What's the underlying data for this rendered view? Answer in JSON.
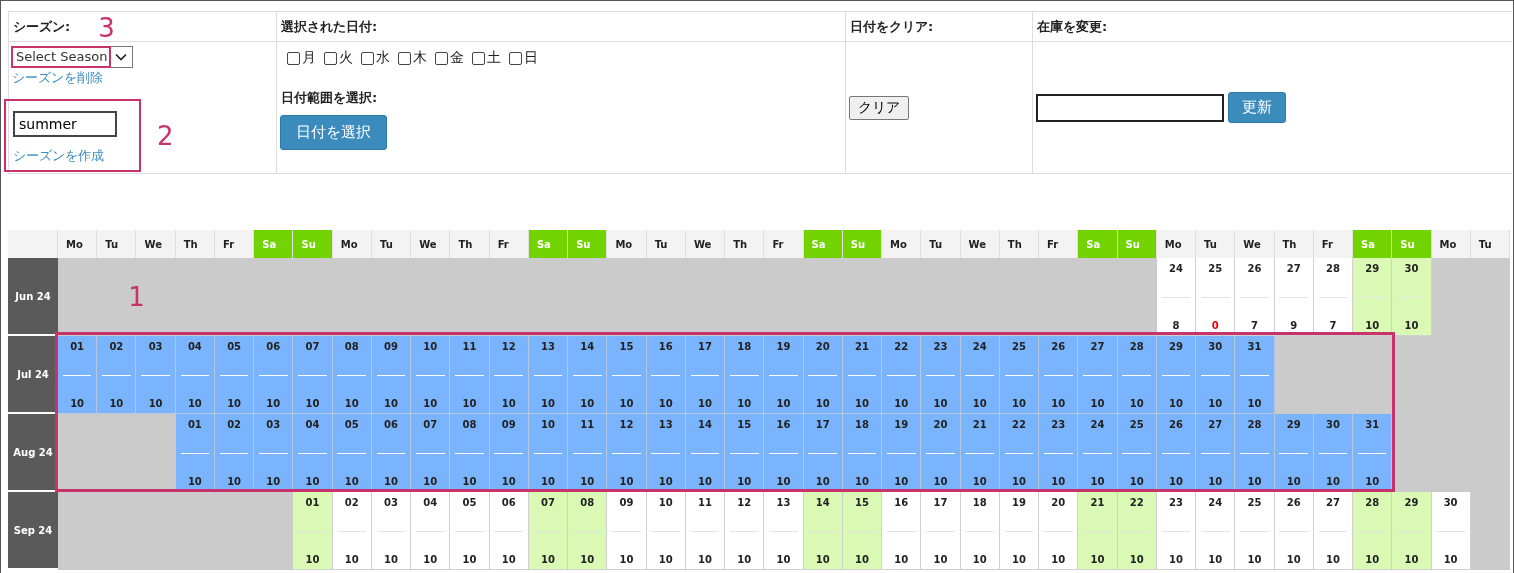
{
  "settings": {
    "season": {
      "title": "シーズン:",
      "select_value": "Select Season",
      "delete_link": "シーズンを削除",
      "annotation": "3"
    },
    "new_season": {
      "value": "summer",
      "create_link": "シーズンを作成",
      "annotation": "2"
    },
    "selected_dates": {
      "title": "選択された日付:",
      "weekdays": [
        {
          "label": "月",
          "checked": false
        },
        {
          "label": "火",
          "checked": false
        },
        {
          "label": "水",
          "checked": false
        },
        {
          "label": "木",
          "checked": false
        },
        {
          "label": "金",
          "checked": false
        },
        {
          "label": "土",
          "checked": false
        },
        {
          "label": "日",
          "checked": false
        }
      ],
      "range_title": "日付範囲を選択:",
      "range_button": "日付を選択"
    },
    "clear": {
      "title": "日付をクリア:",
      "button": "クリア"
    },
    "stock": {
      "title": "在庫を変更:",
      "button": "更新"
    }
  },
  "calendar": {
    "annotation": "1",
    "weekdays": [
      {
        "label": "Mo",
        "weekend": false
      },
      {
        "label": "Tu",
        "weekend": false
      },
      {
        "label": "We",
        "weekend": false
      },
      {
        "label": "Th",
        "weekend": false
      },
      {
        "label": "Fr",
        "weekend": false
      },
      {
        "label": "Sa",
        "weekend": true
      },
      {
        "label": "Su",
        "weekend": true
      },
      {
        "label": "Mo",
        "weekend": false
      },
      {
        "label": "Tu",
        "weekend": false
      },
      {
        "label": "We",
        "weekend": false
      },
      {
        "label": "Th",
        "weekend": false
      },
      {
        "label": "Fr",
        "weekend": false
      },
      {
        "label": "Sa",
        "weekend": true
      },
      {
        "label": "Su",
        "weekend": true
      },
      {
        "label": "Mo",
        "weekend": false
      },
      {
        "label": "Tu",
        "weekend": false
      },
      {
        "label": "We",
        "weekend": false
      },
      {
        "label": "Th",
        "weekend": false
      },
      {
        "label": "Fr",
        "weekend": false
      },
      {
        "label": "Sa",
        "weekend": true
      },
      {
        "label": "Su",
        "weekend": true
      },
      {
        "label": "Mo",
        "weekend": false
      },
      {
        "label": "Tu",
        "weekend": false
      },
      {
        "label": "We",
        "weekend": false
      },
      {
        "label": "Th",
        "weekend": false
      },
      {
        "label": "Fr",
        "weekend": false
      },
      {
        "label": "Sa",
        "weekend": true
      },
      {
        "label": "Su",
        "weekend": true
      },
      {
        "label": "Mo",
        "weekend": false
      },
      {
        "label": "Tu",
        "weekend": false
      },
      {
        "label": "We",
        "weekend": false
      },
      {
        "label": "Th",
        "weekend": false
      },
      {
        "label": "Fr",
        "weekend": false
      },
      {
        "label": "Sa",
        "weekend": true
      },
      {
        "label": "Su",
        "weekend": true
      },
      {
        "label": "Mo",
        "weekend": false
      },
      {
        "label": "Tu",
        "weekend": false
      }
    ],
    "months": [
      {
        "label": "Jun 24",
        "cells": [
          {
            "kind": "empty"
          },
          {
            "kind": "empty"
          },
          {
            "kind": "empty"
          },
          {
            "kind": "empty"
          },
          {
            "kind": "empty"
          },
          {
            "kind": "empty"
          },
          {
            "kind": "empty"
          },
          {
            "kind": "empty"
          },
          {
            "kind": "empty"
          },
          {
            "kind": "empty"
          },
          {
            "kind": "empty"
          },
          {
            "kind": "empty"
          },
          {
            "kind": "empty"
          },
          {
            "kind": "empty"
          },
          {
            "kind": "empty"
          },
          {
            "kind": "empty"
          },
          {
            "kind": "empty"
          },
          {
            "kind": "empty"
          },
          {
            "kind": "empty"
          },
          {
            "kind": "empty"
          },
          {
            "kind": "empty"
          },
          {
            "kind": "empty"
          },
          {
            "kind": "empty"
          },
          {
            "kind": "empty"
          },
          {
            "kind": "empty"
          },
          {
            "kind": "empty"
          },
          {
            "kind": "empty"
          },
          {
            "kind": "empty"
          },
          {
            "kind": "day",
            "day": "24",
            "stock": "8",
            "alert": false,
            "selected": false
          },
          {
            "kind": "day",
            "day": "25",
            "stock": "0",
            "alert": true,
            "selected": false
          },
          {
            "kind": "day",
            "day": "26",
            "stock": "7",
            "alert": false,
            "selected": false
          },
          {
            "kind": "day",
            "day": "27",
            "stock": "9",
            "alert": false,
            "selected": false
          },
          {
            "kind": "day",
            "day": "28",
            "stock": "7",
            "alert": false,
            "selected": false
          },
          {
            "kind": "day",
            "day": "29",
            "stock": "10",
            "alert": false,
            "selected": false
          },
          {
            "kind": "day",
            "day": "30",
            "stock": "10",
            "alert": false,
            "selected": false
          }
        ]
      },
      {
        "label": "Jul 24",
        "cells": [
          {
            "kind": "day",
            "day": "01",
            "stock": "10",
            "alert": false,
            "selected": true
          },
          {
            "kind": "day",
            "day": "02",
            "stock": "10",
            "alert": false,
            "selected": true
          },
          {
            "kind": "day",
            "day": "03",
            "stock": "10",
            "alert": false,
            "selected": true
          },
          {
            "kind": "day",
            "day": "04",
            "stock": "10",
            "alert": false,
            "selected": true
          },
          {
            "kind": "day",
            "day": "05",
            "stock": "10",
            "alert": false,
            "selected": true
          },
          {
            "kind": "day",
            "day": "06",
            "stock": "10",
            "alert": false,
            "selected": true
          },
          {
            "kind": "day",
            "day": "07",
            "stock": "10",
            "alert": false,
            "selected": true
          },
          {
            "kind": "day",
            "day": "08",
            "stock": "10",
            "alert": false,
            "selected": true
          },
          {
            "kind": "day",
            "day": "09",
            "stock": "10",
            "alert": false,
            "selected": true
          },
          {
            "kind": "day",
            "day": "10",
            "stock": "10",
            "alert": false,
            "selected": true
          },
          {
            "kind": "day",
            "day": "11",
            "stock": "10",
            "alert": false,
            "selected": true
          },
          {
            "kind": "day",
            "day": "12",
            "stock": "10",
            "alert": false,
            "selected": true
          },
          {
            "kind": "day",
            "day": "13",
            "stock": "10",
            "alert": false,
            "selected": true
          },
          {
            "kind": "day",
            "day": "14",
            "stock": "10",
            "alert": false,
            "selected": true
          },
          {
            "kind": "day",
            "day": "15",
            "stock": "10",
            "alert": false,
            "selected": true
          },
          {
            "kind": "day",
            "day": "16",
            "stock": "10",
            "alert": false,
            "selected": true
          },
          {
            "kind": "day",
            "day": "17",
            "stock": "10",
            "alert": false,
            "selected": true
          },
          {
            "kind": "day",
            "day": "18",
            "stock": "10",
            "alert": false,
            "selected": true
          },
          {
            "kind": "day",
            "day": "19",
            "stock": "10",
            "alert": false,
            "selected": true
          },
          {
            "kind": "day",
            "day": "20",
            "stock": "10",
            "alert": false,
            "selected": true
          },
          {
            "kind": "day",
            "day": "21",
            "stock": "10",
            "alert": false,
            "selected": true
          },
          {
            "kind": "day",
            "day": "22",
            "stock": "10",
            "alert": false,
            "selected": true
          },
          {
            "kind": "day",
            "day": "23",
            "stock": "10",
            "alert": false,
            "selected": true
          },
          {
            "kind": "day",
            "day": "24",
            "stock": "10",
            "alert": false,
            "selected": true
          },
          {
            "kind": "day",
            "day": "25",
            "stock": "10",
            "alert": false,
            "selected": true
          },
          {
            "kind": "day",
            "day": "26",
            "stock": "10",
            "alert": false,
            "selected": true
          },
          {
            "kind": "day",
            "day": "27",
            "stock": "10",
            "alert": false,
            "selected": true
          },
          {
            "kind": "day",
            "day": "28",
            "stock": "10",
            "alert": false,
            "selected": true
          },
          {
            "kind": "day",
            "day": "29",
            "stock": "10",
            "alert": false,
            "selected": true
          },
          {
            "kind": "day",
            "day": "30",
            "stock": "10",
            "alert": false,
            "selected": true
          },
          {
            "kind": "day",
            "day": "31",
            "stock": "10",
            "alert": false,
            "selected": true
          }
        ]
      },
      {
        "label": "Aug 24",
        "cells": [
          {
            "kind": "empty"
          },
          {
            "kind": "empty"
          },
          {
            "kind": "empty"
          },
          {
            "kind": "day",
            "day": "01",
            "stock": "10",
            "alert": false,
            "selected": true
          },
          {
            "kind": "day",
            "day": "02",
            "stock": "10",
            "alert": false,
            "selected": true
          },
          {
            "kind": "day",
            "day": "03",
            "stock": "10",
            "alert": false,
            "selected": true
          },
          {
            "kind": "day",
            "day": "04",
            "stock": "10",
            "alert": false,
            "selected": true
          },
          {
            "kind": "day",
            "day": "05",
            "stock": "10",
            "alert": false,
            "selected": true
          },
          {
            "kind": "day",
            "day": "06",
            "stock": "10",
            "alert": false,
            "selected": true
          },
          {
            "kind": "day",
            "day": "07",
            "stock": "10",
            "alert": false,
            "selected": true
          },
          {
            "kind": "day",
            "day": "08",
            "stock": "10",
            "alert": false,
            "selected": true
          },
          {
            "kind": "day",
            "day": "09",
            "stock": "10",
            "alert": false,
            "selected": true
          },
          {
            "kind": "day",
            "day": "10",
            "stock": "10",
            "alert": false,
            "selected": true
          },
          {
            "kind": "day",
            "day": "11",
            "stock": "10",
            "alert": false,
            "selected": true
          },
          {
            "kind": "day",
            "day": "12",
            "stock": "10",
            "alert": false,
            "selected": true
          },
          {
            "kind": "day",
            "day": "13",
            "stock": "10",
            "alert": false,
            "selected": true
          },
          {
            "kind": "day",
            "day": "14",
            "stock": "10",
            "alert": false,
            "selected": true
          },
          {
            "kind": "day",
            "day": "15",
            "stock": "10",
            "alert": false,
            "selected": true
          },
          {
            "kind": "day",
            "day": "16",
            "stock": "10",
            "alert": false,
            "selected": true
          },
          {
            "kind": "day",
            "day": "17",
            "stock": "10",
            "alert": false,
            "selected": true
          },
          {
            "kind": "day",
            "day": "18",
            "stock": "10",
            "alert": false,
            "selected": true
          },
          {
            "kind": "day",
            "day": "19",
            "stock": "10",
            "alert": false,
            "selected": true
          },
          {
            "kind": "day",
            "day": "20",
            "stock": "10",
            "alert": false,
            "selected": true
          },
          {
            "kind": "day",
            "day": "21",
            "stock": "10",
            "alert": false,
            "selected": true
          },
          {
            "kind": "day",
            "day": "22",
            "stock": "10",
            "alert": false,
            "selected": true
          },
          {
            "kind": "day",
            "day": "23",
            "stock": "10",
            "alert": false,
            "selected": true
          },
          {
            "kind": "day",
            "day": "24",
            "stock": "10",
            "alert": false,
            "selected": true
          },
          {
            "kind": "day",
            "day": "25",
            "stock": "10",
            "alert": false,
            "selected": true
          },
          {
            "kind": "day",
            "day": "26",
            "stock": "10",
            "alert": false,
            "selected": true
          },
          {
            "kind": "day",
            "day": "27",
            "stock": "10",
            "alert": false,
            "selected": true
          },
          {
            "kind": "day",
            "day": "28",
            "stock": "10",
            "alert": false,
            "selected": true
          },
          {
            "kind": "day",
            "day": "29",
            "stock": "10",
            "alert": false,
            "selected": true
          },
          {
            "kind": "day",
            "day": "30",
            "stock": "10",
            "alert": false,
            "selected": true
          },
          {
            "kind": "day",
            "day": "31",
            "stock": "10",
            "alert": false,
            "selected": true
          }
        ]
      },
      {
        "label": "Sep 24",
        "cells": [
          {
            "kind": "empty"
          },
          {
            "kind": "empty"
          },
          {
            "kind": "empty"
          },
          {
            "kind": "empty"
          },
          {
            "kind": "empty"
          },
          {
            "kind": "empty"
          },
          {
            "kind": "day",
            "day": "01",
            "stock": "10",
            "alert": false,
            "selected": false
          },
          {
            "kind": "day",
            "day": "02",
            "stock": "10",
            "alert": false,
            "selected": false
          },
          {
            "kind": "day",
            "day": "03",
            "stock": "10",
            "alert": false,
            "selected": false
          },
          {
            "kind": "day",
            "day": "04",
            "stock": "10",
            "alert": false,
            "selected": false
          },
          {
            "kind": "day",
            "day": "05",
            "stock": "10",
            "alert": false,
            "selected": false
          },
          {
            "kind": "day",
            "day": "06",
            "stock": "10",
            "alert": false,
            "selected": false
          },
          {
            "kind": "day",
            "day": "07",
            "stock": "10",
            "alert": false,
            "selected": false
          },
          {
            "kind": "day",
            "day": "08",
            "stock": "10",
            "alert": false,
            "selected": false
          },
          {
            "kind": "day",
            "day": "09",
            "stock": "10",
            "alert": false,
            "selected": false
          },
          {
            "kind": "day",
            "day": "10",
            "stock": "10",
            "alert": false,
            "selected": false
          },
          {
            "kind": "day",
            "day": "11",
            "stock": "10",
            "alert": false,
            "selected": false
          },
          {
            "kind": "day",
            "day": "12",
            "stock": "10",
            "alert": false,
            "selected": false
          },
          {
            "kind": "day",
            "day": "13",
            "stock": "10",
            "alert": false,
            "selected": false
          },
          {
            "kind": "day",
            "day": "14",
            "stock": "10",
            "alert": false,
            "selected": false
          },
          {
            "kind": "day",
            "day": "15",
            "stock": "10",
            "alert": false,
            "selected": false
          },
          {
            "kind": "day",
            "day": "16",
            "stock": "10",
            "alert": false,
            "selected": false
          },
          {
            "kind": "day",
            "day": "17",
            "stock": "10",
            "alert": false,
            "selected": false
          },
          {
            "kind": "day",
            "day": "18",
            "stock": "10",
            "alert": false,
            "selected": false
          },
          {
            "kind": "day",
            "day": "19",
            "stock": "10",
            "alert": false,
            "selected": false
          },
          {
            "kind": "day",
            "day": "20",
            "stock": "10",
            "alert": false,
            "selected": false
          },
          {
            "kind": "day",
            "day": "21",
            "stock": "10",
            "alert": false,
            "selected": false
          },
          {
            "kind": "day",
            "day": "22",
            "stock": "10",
            "alert": false,
            "selected": false
          },
          {
            "kind": "day",
            "day": "23",
            "stock": "10",
            "alert": false,
            "selected": false
          },
          {
            "kind": "day",
            "day": "24",
            "stock": "10",
            "alert": false,
            "selected": false
          },
          {
            "kind": "day",
            "day": "25",
            "stock": "10",
            "alert": false,
            "selected": false
          },
          {
            "kind": "day",
            "day": "26",
            "stock": "10",
            "alert": false,
            "selected": false
          },
          {
            "kind": "day",
            "day": "27",
            "stock": "10",
            "alert": false,
            "selected": false
          },
          {
            "kind": "day",
            "day": "28",
            "stock": "10",
            "alert": false,
            "selected": false
          },
          {
            "kind": "day",
            "day": "29",
            "stock": "10",
            "alert": false,
            "selected": false
          },
          {
            "kind": "day",
            "day": "30",
            "stock": "10",
            "alert": false,
            "selected": false
          }
        ]
      }
    ]
  }
}
